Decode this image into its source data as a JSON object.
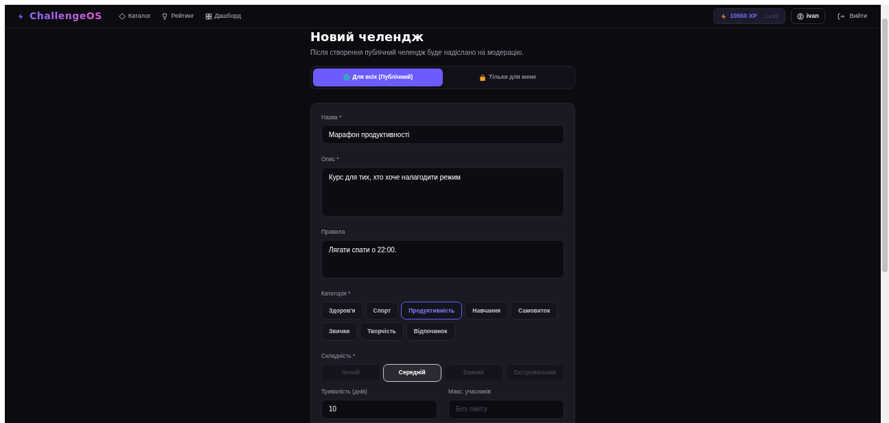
{
  "brand": "ChallengeOS",
  "nav": [
    {
      "label": "Каталог"
    },
    {
      "label": "Рейтинг"
    },
    {
      "label": "Дашборд"
    }
  ],
  "user": {
    "xp": "10550 XP",
    "level": "Lv.29",
    "name": "ivan",
    "logout": "Вийти"
  },
  "title": "Новий челендж",
  "subtitle": "Після створення публічний челендж буде надіслано на модерацію.",
  "visibility": [
    {
      "label": "Для всіх (Публічний)",
      "selected": true
    },
    {
      "label": "Тільки для мене",
      "selected": false
    }
  ],
  "fields": [
    {
      "label": "Назва *",
      "kind": "input",
      "value": "Марафон продуктивності"
    },
    {
      "label": "Опис *",
      "kind": "textarea",
      "value": "Курс для тих, хто хоче налагодити режим"
    },
    {
      "label": "Правила",
      "kind": "textarea-small",
      "value": "Лягати спати о 22:00."
    }
  ],
  "categories": {
    "label": "Категорія *",
    "items": [
      {
        "label": "Здоров'я",
        "selected": false
      },
      {
        "label": "Спорт",
        "selected": false
      },
      {
        "label": "Продуктивність",
        "selected": true
      },
      {
        "label": "Навчання",
        "selected": false
      },
      {
        "label": "Самовиток",
        "selected": false
      },
      {
        "label": "Звички",
        "selected": false
      },
      {
        "label": "Творчість",
        "selected": false
      },
      {
        "label": "Відпочинок",
        "selected": false
      }
    ]
  },
  "difficulty": {
    "label": "Складність *",
    "items": [
      {
        "label": "Легкий",
        "selected": false
      },
      {
        "label": "Середній",
        "selected": true
      },
      {
        "label": "Важкий",
        "selected": false
      },
      {
        "label": "Екстремальний",
        "selected": false
      }
    ]
  },
  "numbers": [
    {
      "label": "Тривалість (днів)",
      "value": "10"
    },
    {
      "label": "Макс. учасників",
      "placeholder": "Без ліміту"
    }
  ]
}
